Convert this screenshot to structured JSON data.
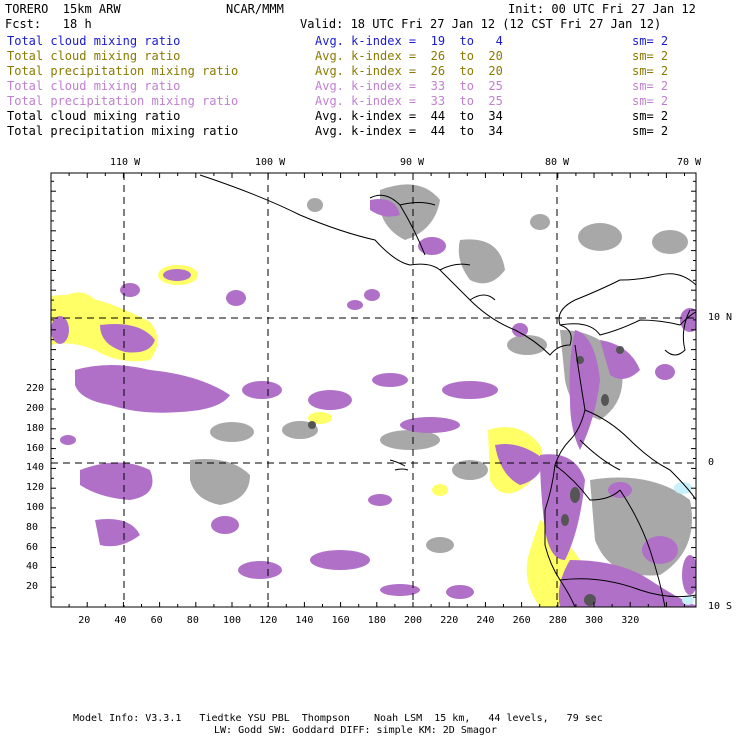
{
  "header": {
    "model": "TORERO  15km ARW",
    "org": "NCAR/MMM",
    "init": "Init: 00 UTC Fri 27 Jan 12",
    "fcst": "Fcst:   18 h",
    "valid": "Valid: 18 UTC Fri 27 Jan 12 (12 CST Fri 27 Jan 12)"
  },
  "legend": [
    {
      "field": "Total cloud mixing ratio",
      "index": "Avg. k-index =  19  to   4",
      "sm": "sm= 2",
      "color": "#1a1ad0"
    },
    {
      "field": "Total cloud mixing ratio",
      "index": "Avg. k-index =  26  to  20",
      "sm": "sm= 2",
      "color": "#8a7a00"
    },
    {
      "field": "Total precipitation mixing ratio",
      "index": "Avg. k-index =  26  to  20",
      "sm": "sm= 2",
      "color": "#8a7a00"
    },
    {
      "field": "Total cloud mixing ratio",
      "index": "Avg. k-index =  33  to  25",
      "sm": "sm= 2",
      "color": "#c080d0"
    },
    {
      "field": "Total precipitation mixing ratio",
      "index": "Avg. k-index =  33  to  25",
      "sm": "sm= 2",
      "color": "#c080d0"
    },
    {
      "field": "Total cloud mixing ratio",
      "index": "Avg. k-index =  44  to  34",
      "sm": "sm= 2",
      "color": "#000000"
    },
    {
      "field": "Total precipitation mixing ratio",
      "index": "Avg. k-index =  44  to  34",
      "sm": "sm= 2",
      "color": "#000000"
    }
  ],
  "map": {
    "lon_labels": [
      "110 W",
      "100 W",
      "90 W",
      "80 W",
      "70 W"
    ],
    "lat_labels": [
      "10 N",
      "0",
      "10 S"
    ],
    "x_ticks": [
      "20",
      "40",
      "60",
      "80",
      "100",
      "120",
      "140",
      "160",
      "180",
      "200",
      "220",
      "240",
      "260",
      "280",
      "300",
      "320"
    ],
    "y_ticks": [
      "220",
      "200",
      "180",
      "160",
      "140",
      "120",
      "100",
      "80",
      "60",
      "40",
      "20"
    ],
    "colors": {
      "gray": "#a8a8a8",
      "purple": "#b070c8",
      "yellow": "#ffff66",
      "dark": "#505050",
      "cyan": "#c8f0f8"
    }
  },
  "footer": {
    "line1": "Model Info: V3.3.1   Tiedtke YSU PBL  Thompson    Noah LSM  15 km,   44 levels,   79 sec",
    "line2": "LW: Godd SW: Goddard DIFF: simple KM: 2D Smagor"
  }
}
